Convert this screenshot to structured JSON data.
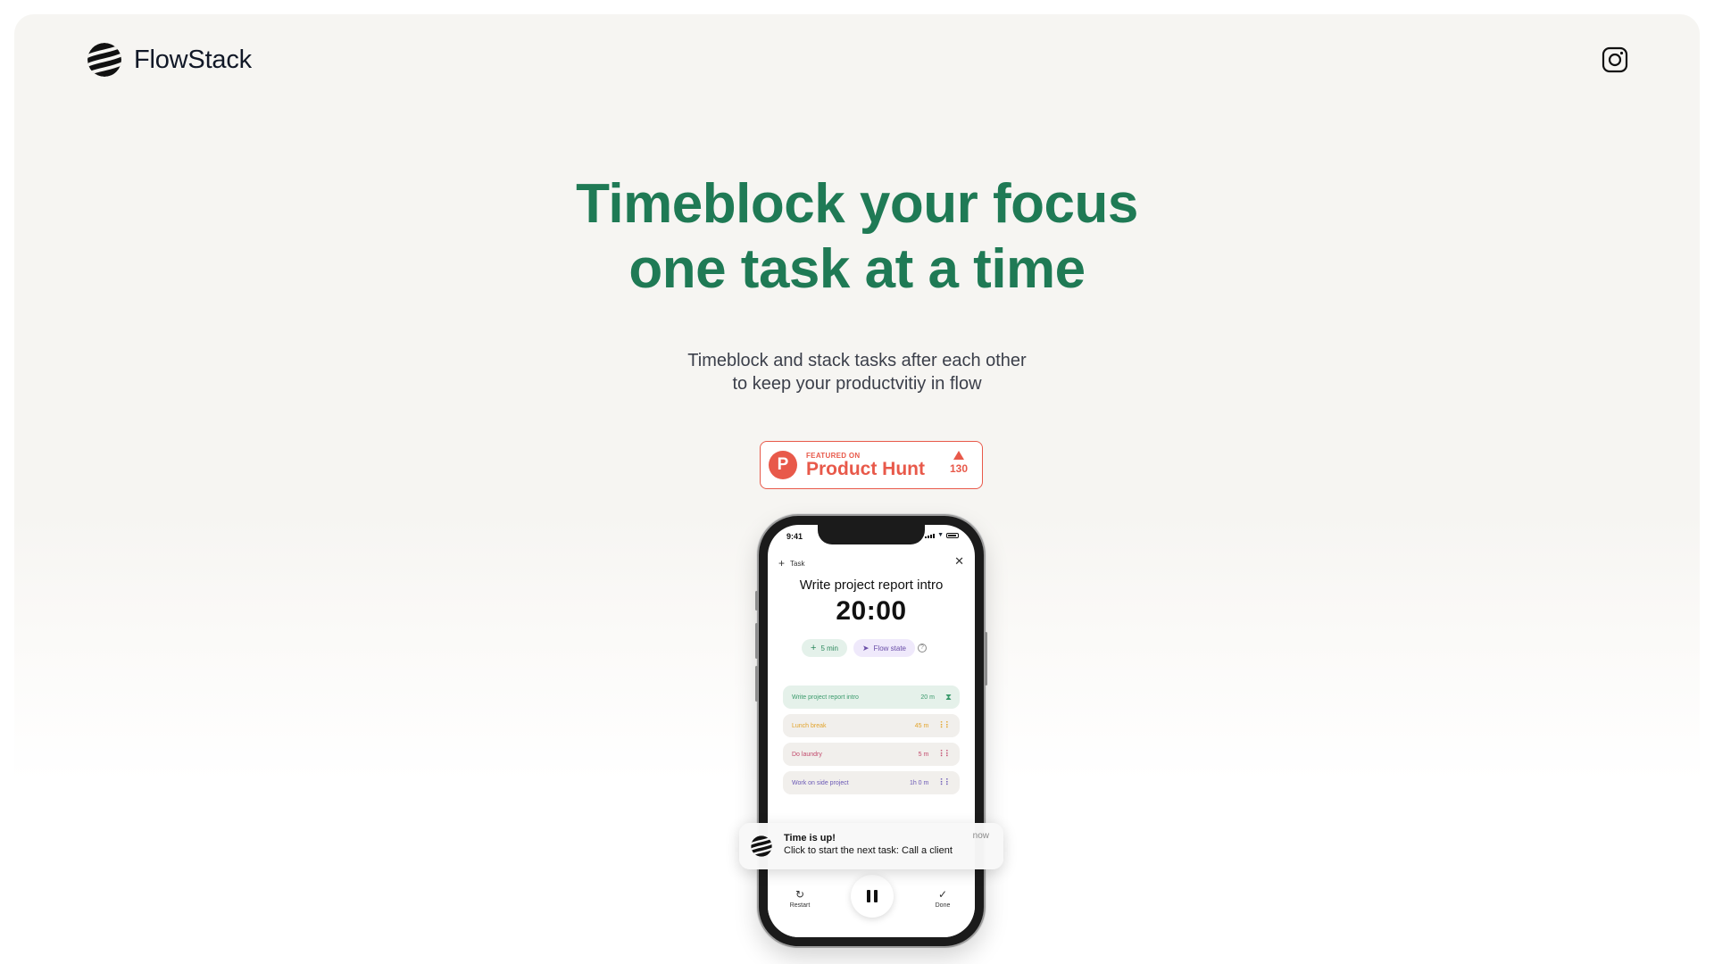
{
  "header": {
    "brand": "FlowStack",
    "logo_icon": "flowstack-logo-icon",
    "social_icon": "instagram-icon"
  },
  "hero": {
    "title_line1": "Timeblock your focus",
    "title_line2": "one task at a time",
    "subtitle_line1": "Timeblock and stack tasks after each other",
    "subtitle_line2": "to keep your productvitiy in flow"
  },
  "product_hunt": {
    "logo_letter": "P",
    "featured_label": "FEATURED ON",
    "name": "Product Hunt",
    "votes": "130"
  },
  "phone": {
    "status_time": "9:41",
    "task_header": "Task",
    "task_title": "Write project report intro",
    "timer": "20:00",
    "chip_add": "5 min",
    "chip_flow": "Flow state",
    "tasks": [
      {
        "name": "Write project report intro",
        "time": "20 m",
        "bg": "#e5f1ea",
        "color": "#3b9a6c",
        "icon": "hourglass-icon"
      },
      {
        "name": "Lunch break",
        "time": "45 m",
        "bg": "#f1efec",
        "color": "#e2a32a",
        "icon": "drag-handle-icon"
      },
      {
        "name": "Do laundry",
        "time": "5 m",
        "bg": "#f1efec",
        "color": "#c24a6c",
        "icon": "drag-handle-icon"
      },
      {
        "name": "Work on side project",
        "time": "1h 0 m",
        "bg": "#f1efec",
        "color": "#6a58b5",
        "icon": "drag-handle-icon"
      }
    ],
    "bottom": {
      "restart": "Restart",
      "done": "Done"
    }
  },
  "notification": {
    "title": "Time is up!",
    "body": "Click to start the next task: Call a client",
    "time": "now"
  },
  "colors": {
    "accent_green": "#1f7a55",
    "product_hunt_red": "#e8594a",
    "background": "#f6f5f2"
  }
}
